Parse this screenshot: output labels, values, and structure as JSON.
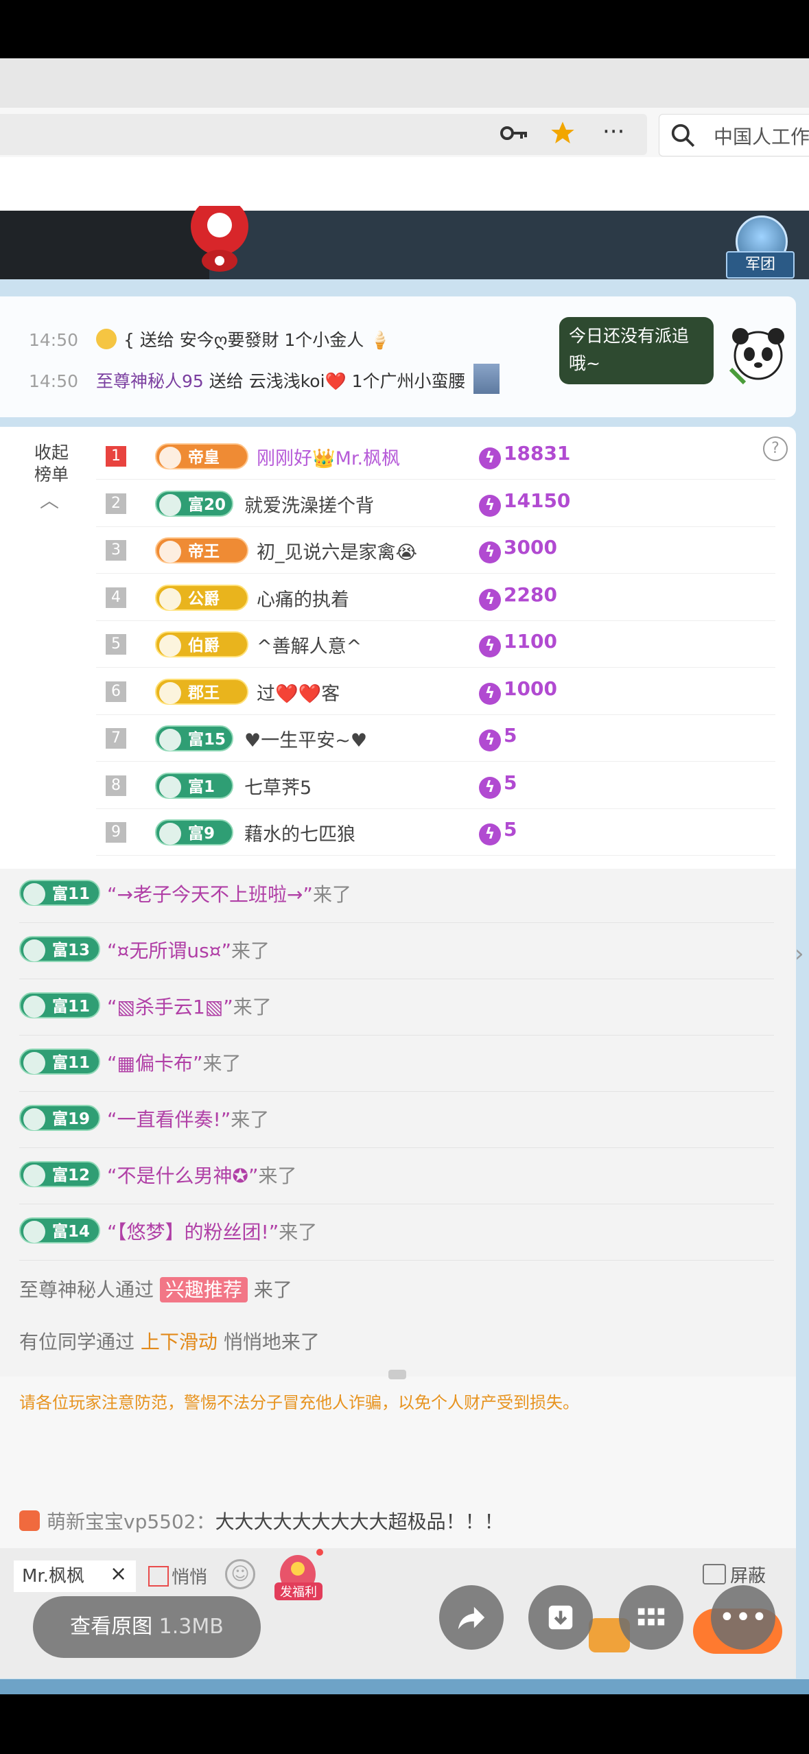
{
  "browser": {
    "search_text": "中国人工作",
    "key_icon": "key-icon",
    "star_icon": "star-icon",
    "more_icon": "more-icon"
  },
  "header": {
    "legion_label": "军团"
  },
  "ticker": {
    "lines": [
      {
        "time": "14:50",
        "text": "{ 送给 安今ღ要發財 1个小金人 🍦"
      },
      {
        "time": "14:50",
        "user": "至尊神秘人95",
        "text": " 送给 云浅浅koi❤️ 1个广州小蛮腰"
      }
    ],
    "bubble": "今日还没有派追哦~"
  },
  "ranking": {
    "collapse_label": "收起榜单",
    "help": "?",
    "rows": [
      {
        "rank": "1",
        "badge": "帝皇",
        "badge_style": "orange",
        "name": "刚刚好👑Mr.枫枫",
        "name_style": "purple",
        "score": "18831"
      },
      {
        "rank": "2",
        "badge": "富20",
        "badge_style": "green",
        "name": "就爱洗澡搓个背",
        "score": "14150"
      },
      {
        "rank": "3",
        "badge": "帝王",
        "badge_style": "orange",
        "name": "初_见说六是家禽😭",
        "score": "3000"
      },
      {
        "rank": "4",
        "badge": "公爵",
        "badge_style": "gold",
        "name": "心痛的执着",
        "score": "2280"
      },
      {
        "rank": "5",
        "badge": "伯爵",
        "badge_style": "gold",
        "name": "^善解人意^",
        "score": "1100"
      },
      {
        "rank": "6",
        "badge": "郡王",
        "badge_style": "gold",
        "name": "过❤️❤️客",
        "score": "1000"
      },
      {
        "rank": "7",
        "badge": "富15",
        "badge_style": "green",
        "name": "♥一生平安~♥",
        "score": "5"
      },
      {
        "rank": "8",
        "badge": "富1",
        "badge_style": "green",
        "name": "七草荠5",
        "score": "5"
      },
      {
        "rank": "9",
        "badge": "富9",
        "badge_style": "green",
        "name": "藉水的七匹狼",
        "score": "5"
      }
    ]
  },
  "chat": {
    "arrivals": [
      {
        "badge": "富11",
        "name": "“→老子今天不上班啦→”",
        "suffix": "来了"
      },
      {
        "badge": "富13",
        "name": "“¤无所谓us¤”",
        "suffix": "来了"
      },
      {
        "badge": "富11",
        "name": "“▧杀手云1▧”",
        "suffix": "来了"
      },
      {
        "badge": "富11",
        "name": "“▦偏卡布”",
        "suffix": "来了"
      },
      {
        "badge": "富19",
        "name": "“一直看伴奏!”",
        "suffix": "来了"
      },
      {
        "badge": "富12",
        "name": "“不是什么男神✪”",
        "suffix": "来了"
      },
      {
        "badge": "富14",
        "name": "“【悠梦】的粉丝团!”",
        "suffix": "来了"
      }
    ],
    "sys1": {
      "prefix": "至尊神秘人通过 ",
      "tag": "兴趣推荐",
      "suffix": " 来了"
    },
    "sys2": {
      "prefix": "有位同学通过 ",
      "tag": "上下滑动",
      "suffix": " 悄悄地来了"
    },
    "warning": "请各位玩家注意防范，警惕不法分子冒充他人诈骗，以免个人财产受到损失。",
    "gift": {
      "user": "萌新宝宝vp5502：",
      "text": "大大大大大大大大大超极品！！！"
    }
  },
  "input_bar": {
    "recipient": "Mr.枫枫",
    "close": "×",
    "quiet_label": "悄悄",
    "gift_label": "发福利",
    "block_label": "屏蔽"
  },
  "viewer": {
    "view_original": "查看原图",
    "size": "1.3MB",
    "actions": [
      "share-icon",
      "download-icon",
      "grid-icon",
      "more-icon"
    ]
  }
}
